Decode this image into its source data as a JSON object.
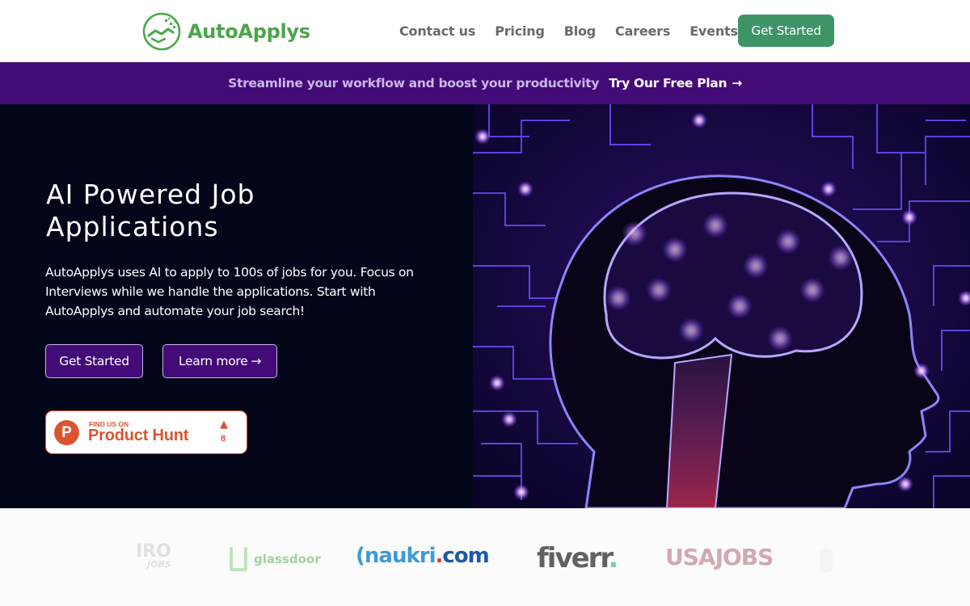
{
  "header": {
    "brand_name": "AutoApplys",
    "nav_items": [
      {
        "label": "Contact us"
      },
      {
        "label": "Pricing"
      },
      {
        "label": "Blog"
      },
      {
        "label": "Careers"
      },
      {
        "label": "Events"
      }
    ],
    "cta_label": "Get Started"
  },
  "promo": {
    "text": "Streamline your workflow and boost your productivity",
    "link_label": "Try Our Free Plan",
    "link_icon": "arrow-right-icon"
  },
  "hero": {
    "title_line1": "AI Powered Job",
    "title_line2": "Applications",
    "description": "AutoApplys uses AI to apply to 100s of jobs for you. Focus on Interviews while we handle the applications. Start with AutoApplys and automate your job search!",
    "primary_button": "Get Started",
    "secondary_button": "Learn more",
    "secondary_icon": "arrow-right-icon",
    "image_alt": "AI brain circuit illustration"
  },
  "product_hunt": {
    "small_text": "FIND US ON",
    "big_text": "Product Hunt",
    "logo_letter": "P",
    "upvote_icon": "triangle-up-icon",
    "upvote_count": "8"
  },
  "partner_logos": [
    {
      "name": "IRO JOBS",
      "main": "IRO",
      "sub": "JOBS"
    },
    {
      "name": "glassdoor",
      "text": "glassdoor"
    },
    {
      "name": "naukri.com",
      "main": "naukri",
      "dot": ".",
      "suffix": "com"
    },
    {
      "name": "fiverr",
      "main": "fiverr",
      "dot": "."
    },
    {
      "name": "USAJOBS",
      "text": "USAJOBS"
    }
  ],
  "colors": {
    "brand_green": "#4aa64a",
    "cta_green": "#3f9467",
    "promo_purple": "#430b77",
    "hero_bg": "#030619",
    "product_hunt_orange": "#da552f"
  }
}
